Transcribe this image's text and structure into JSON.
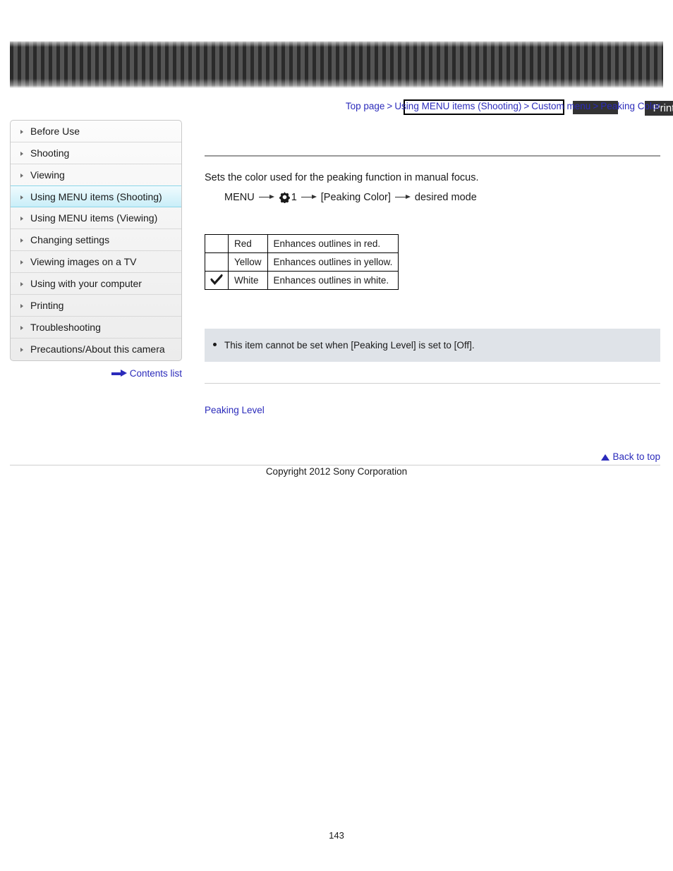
{
  "header": {
    "search": {
      "value": "",
      "placeholder": ""
    },
    "search_button_label": "",
    "print_button_label": "Print"
  },
  "breadcrumb": {
    "items": [
      "Top page",
      "Using MENU items (Shooting)",
      "Custom menu",
      "Peaking Color"
    ],
    "separator": ">"
  },
  "sidebar": {
    "items": [
      {
        "label": "Before Use",
        "active": false
      },
      {
        "label": "Shooting",
        "active": false
      },
      {
        "label": "Viewing",
        "active": false
      },
      {
        "label": "Using MENU items (Shooting)",
        "active": true
      },
      {
        "label": "Using MENU items (Viewing)",
        "active": false
      },
      {
        "label": "Changing settings",
        "active": false
      },
      {
        "label": "Viewing images on a TV",
        "active": false
      },
      {
        "label": "Using with your computer",
        "active": false
      },
      {
        "label": "Printing",
        "active": false
      },
      {
        "label": "Troubleshooting",
        "active": false
      },
      {
        "label": "Precautions/About this camera",
        "active": false
      }
    ],
    "contents_list_label": "Contents list"
  },
  "main": {
    "intro": "Sets the color used for the peaking function in manual focus.",
    "menu_path": {
      "start": "MENU",
      "gear_number": "1",
      "item": "[Peaking Color]",
      "end": "desired mode"
    },
    "table": {
      "rows": [
        {
          "checked": "",
          "name": "Red",
          "desc": "Enhances outlines in red."
        },
        {
          "checked": "",
          "name": "Yellow",
          "desc": "Enhances outlines in yellow."
        },
        {
          "checked": "✓",
          "name": "White",
          "desc": "Enhances outlines in white."
        }
      ]
    },
    "note": "This item cannot be set when [Peaking Level] is set to [Off].",
    "related_link": "Peaking Level"
  },
  "footer": {
    "back_to_top": "Back to top",
    "copyright": "Copyright 2012 Sony Corporation",
    "page_number": "143"
  },
  "colors": {
    "link": "#2b2bbb",
    "highlight": "#c9eef8",
    "note_bg": "#dfe3e8"
  }
}
